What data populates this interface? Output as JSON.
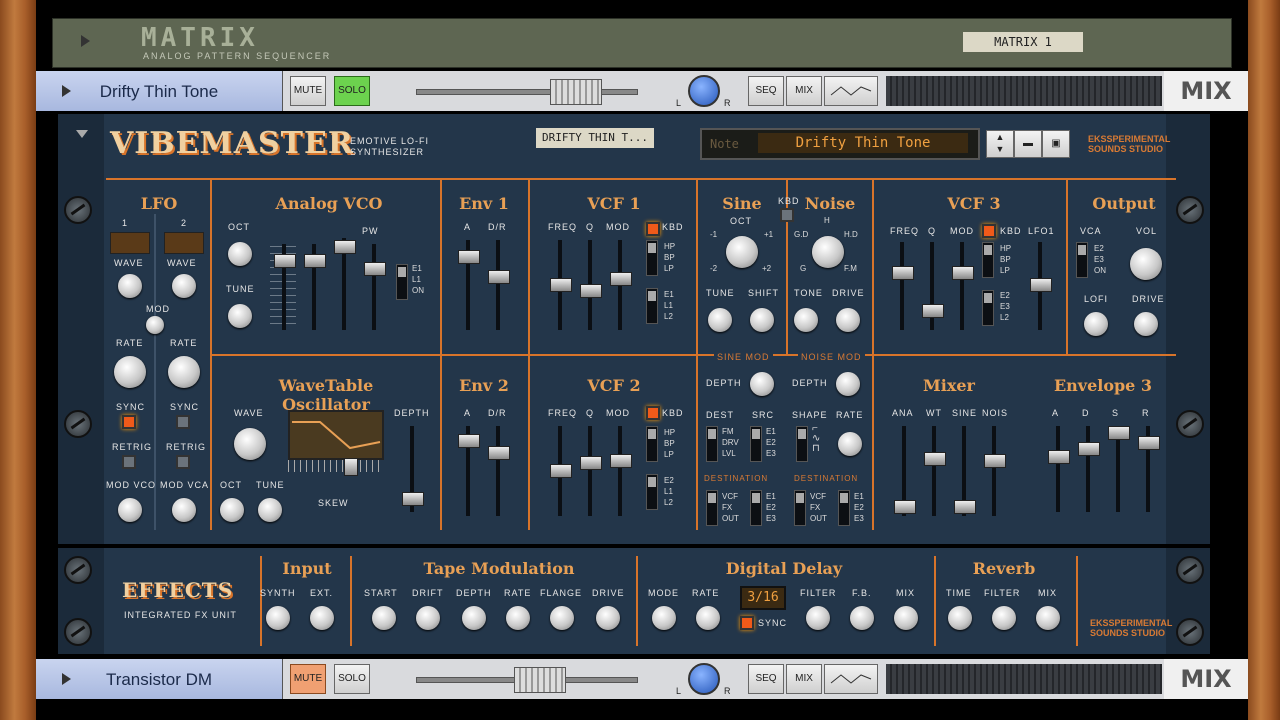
{
  "matrix": {
    "logo": "MATRIX",
    "subtitle": "ANALOG PATTERN SEQUENCER",
    "tape_label": "MATRIX 1"
  },
  "strip1": {
    "name": "Drifty Thin Tone",
    "mute": "MUTE",
    "solo": "SOLO",
    "pan_left": "L",
    "pan_right": "R",
    "seq": "SEQ",
    "mix": "MIX",
    "mix_label": "MIX"
  },
  "strip2": {
    "name": "Transistor DM",
    "mute": "MUTE",
    "solo": "SOLO",
    "pan_left": "L",
    "pan_right": "R",
    "seq": "SEQ",
    "mix": "MIX",
    "mix_label": "MIX"
  },
  "synth": {
    "brand": "VIBEMASTER",
    "brand_sub1": "EMOTIVE LO-FI",
    "brand_sub2": "SYNTHESIZER",
    "tape_label": "DRIFTY THIN T...",
    "patch_prefix": "Note",
    "patch_name": "Drifty Thin Tone",
    "maker1": "EKSSPERIMENTAL",
    "maker2": "SOUNDS STUDIO"
  },
  "lfo": {
    "title": "LFO",
    "n1": "1",
    "n2": "2",
    "wave": "WAVE",
    "mod": "MOD",
    "rate": "RATE",
    "sync": "SYNC",
    "retrig": "RETRIG",
    "mod_vco": "MOD VCO",
    "mod_vca": "MOD VCA"
  },
  "vco": {
    "title": "Analog VCO",
    "oct": "OCT",
    "tune": "TUNE",
    "pw": "PW",
    "e1": "E1",
    "l1": "L1",
    "on": "ON"
  },
  "env1": {
    "title": "Env 1",
    "a": "A",
    "dr": "D/R"
  },
  "vcf1": {
    "title": "VCF 1",
    "freq": "FREQ",
    "q": "Q",
    "mod": "MOD",
    "kbd": "KBD",
    "hp": "HP",
    "bp": "BP",
    "lp": "LP",
    "e1": "E1",
    "l1": "L1",
    "l2": "L2"
  },
  "sine": {
    "title": "Sine",
    "oct": "OCT",
    "m1": "-1",
    "p1": "+1",
    "m2": "-2",
    "p2": "+2",
    "tune": "TUNE",
    "shift": "SHIFT",
    "kbd": "KBD"
  },
  "noise": {
    "title": "Noise",
    "h": "H",
    "gd": "G.D",
    "hd": "H.D",
    "g": "G",
    "fm": "F.M",
    "tone": "TONE",
    "drive": "DRIVE"
  },
  "vcf3": {
    "title": "VCF 3",
    "freq": "FREQ",
    "q": "Q",
    "mod": "MOD",
    "kbd": "KBD",
    "lfo1": "LFO1",
    "hp": "HP",
    "bp": "BP",
    "lp": "LP",
    "e2": "E2",
    "e3": "E3",
    "l2": "L2"
  },
  "output": {
    "title": "Output",
    "vca": "VCA",
    "vol": "VOL",
    "e2": "E2",
    "e3": "E3",
    "on": "ON",
    "lofi": "LOFI",
    "drive": "DRIVE"
  },
  "wt": {
    "title": "WaveTable Oscillator",
    "wave": "WAVE",
    "depth": "DEPTH",
    "oct": "OCT",
    "tune": "TUNE",
    "skew": "SKEW"
  },
  "env2": {
    "title": "Env 2",
    "a": "A",
    "dr": "D/R"
  },
  "vcf2": {
    "title": "VCF 2",
    "freq": "FREQ",
    "q": "Q",
    "mod": "MOD",
    "kbd": "KBD",
    "hp": "HP",
    "bp": "BP",
    "lp": "LP",
    "e2": "E2",
    "l1": "L1",
    "l2": "L2"
  },
  "sinemod": {
    "title": "SINE MOD",
    "depth": "DEPTH",
    "dest": "DEST",
    "src": "SRC",
    "fm": "FM",
    "drv": "DRV",
    "lvl": "LVL",
    "e1": "E1",
    "e2": "E2",
    "e3": "E3",
    "destination": "DESTINATION",
    "vcf": "VCF",
    "fx": "FX",
    "out": "OUT"
  },
  "noisemod": {
    "title": "NOISE MOD",
    "depth": "DEPTH",
    "shape": "SHAPE",
    "rate": "RATE",
    "destination": "DESTINATION",
    "vcf": "VCF",
    "fx": "FX",
    "out": "OUT",
    "e1": "E1",
    "e2": "E2",
    "e3": "E3"
  },
  "mixer": {
    "title": "Mixer",
    "ana": "ANA",
    "wt": "WT",
    "sine": "SINE",
    "nois": "NOIS"
  },
  "env3": {
    "title": "Envelope 3",
    "a": "A",
    "d": "D",
    "s": "S",
    "r": "R"
  },
  "fx": {
    "brand": "EFFECTS",
    "brand_sub": "INTEGRATED FX UNIT",
    "input": {
      "title": "Input",
      "synth": "SYNTH",
      "ext": "EXT."
    },
    "tape": {
      "title": "Tape Modulation",
      "start": "START",
      "drift": "DRIFT",
      "depth": "DEPTH",
      "rate": "RATE",
      "flange": "FLANGE",
      "drive": "DRIVE"
    },
    "delay": {
      "title": "Digital Delay",
      "mode": "MODE",
      "rate": "RATE",
      "time_display": "3/16",
      "sync": "SYNC",
      "filter": "FILTER",
      "fb": "F.B.",
      "mix": "MIX"
    },
    "reverb": {
      "title": "Reverb",
      "time": "TIME",
      "filter": "FILTER",
      "mix": "MIX"
    },
    "maker1": "EKSSPERIMENTAL",
    "maker2": "SOUNDS STUDIO"
  },
  "colors": {
    "accent": "#d8742a",
    "panel": "#23364a",
    "title": "#e8a055"
  }
}
